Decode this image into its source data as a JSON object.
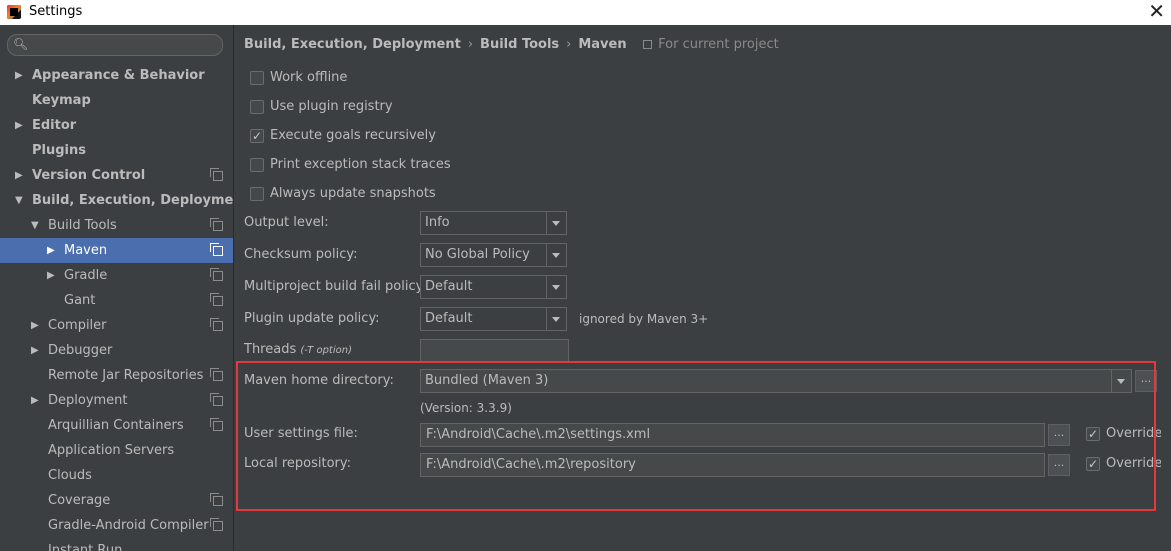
{
  "window": {
    "title": "Settings",
    "close_glyph": "✕"
  },
  "sidebar": {
    "search": {
      "placeholder": "",
      "icon": "search-icon"
    },
    "items": [
      {
        "label": "Appearance & Behavior",
        "bold": true,
        "arrow": "▶",
        "pin": false
      },
      {
        "label": "Keymap",
        "bold": true,
        "arrow": "",
        "pin": false
      },
      {
        "label": "Editor",
        "bold": true,
        "arrow": "▶",
        "pin": false
      },
      {
        "label": "Plugins",
        "bold": true,
        "arrow": "",
        "pin": false
      },
      {
        "label": "Version Control",
        "bold": true,
        "arrow": "▶",
        "pin": true
      },
      {
        "label": "Build, Execution, Deployment",
        "bold": true,
        "arrow": "▼",
        "pin": false
      },
      {
        "label": "Build Tools",
        "bold": false,
        "arrow": "▼",
        "pin": true
      },
      {
        "label": "Maven",
        "bold": false,
        "arrow": "▶",
        "pin": true,
        "selected": true
      },
      {
        "label": "Gradle",
        "bold": false,
        "arrow": "▶",
        "pin": true
      },
      {
        "label": "Gant",
        "bold": false,
        "arrow": "",
        "pin": true
      },
      {
        "label": "Compiler",
        "bold": false,
        "arrow": "▶",
        "pin": true
      },
      {
        "label": "Debugger",
        "bold": false,
        "arrow": "▶",
        "pin": false
      },
      {
        "label": "Remote Jar Repositories",
        "bold": false,
        "arrow": "",
        "pin": true
      },
      {
        "label": "Deployment",
        "bold": false,
        "arrow": "▶",
        "pin": true
      },
      {
        "label": "Arquillian Containers",
        "bold": false,
        "arrow": "",
        "pin": true
      },
      {
        "label": "Application Servers",
        "bold": false,
        "arrow": "",
        "pin": false
      },
      {
        "label": "Clouds",
        "bold": false,
        "arrow": "",
        "pin": false
      },
      {
        "label": "Coverage",
        "bold": false,
        "arrow": "",
        "pin": true
      },
      {
        "label": "Gradle-Android Compiler",
        "bold": false,
        "arrow": "",
        "pin": true
      },
      {
        "label": "Instant Run",
        "bold": false,
        "arrow": "",
        "pin": false
      }
    ]
  },
  "breadcrumb": {
    "parts": [
      "Build, Execution, Deployment",
      "Build Tools",
      "Maven"
    ],
    "separator": "›",
    "note": "For current project"
  },
  "checkboxes": [
    {
      "label": "Work offline",
      "checked": false
    },
    {
      "label": "Use plugin registry",
      "checked": false
    },
    {
      "label": "Execute goals recursively",
      "checked": true
    },
    {
      "label": "Print exception stack traces",
      "checked": false
    },
    {
      "label": "Always update snapshots",
      "checked": false
    }
  ],
  "form": {
    "output_level": {
      "label": "Output level:",
      "value": "Info"
    },
    "checksum_policy": {
      "label": "Checksum policy:",
      "value": "No Global Policy"
    },
    "multiproject_fail": {
      "label": "Multiproject build fail policy:",
      "value": "Default"
    },
    "plugin_update": {
      "label": "Plugin update policy:",
      "value": "Default",
      "note": "ignored by Maven 3+"
    },
    "threads": {
      "label": "Threads",
      "hint": "(-T option)",
      "value": ""
    },
    "maven_home": {
      "label": "Maven home directory:",
      "value": "Bundled (Maven 3)",
      "version": "(Version: 3.3.9)"
    },
    "user_settings": {
      "label": "User settings file:",
      "value": "F:\\Android\\Cache\\.m2\\settings.xml",
      "override_label": "Override",
      "override_checked": true
    },
    "local_repo": {
      "label": "Local repository:",
      "value": "F:\\Android\\Cache\\.m2\\repository",
      "override_label": "Override",
      "override_checked": true
    },
    "browse_glyph": "..."
  },
  "colors": {
    "background": "#3c3f41",
    "selection": "#4b6eaf",
    "highlight_box": "#e4393c"
  }
}
